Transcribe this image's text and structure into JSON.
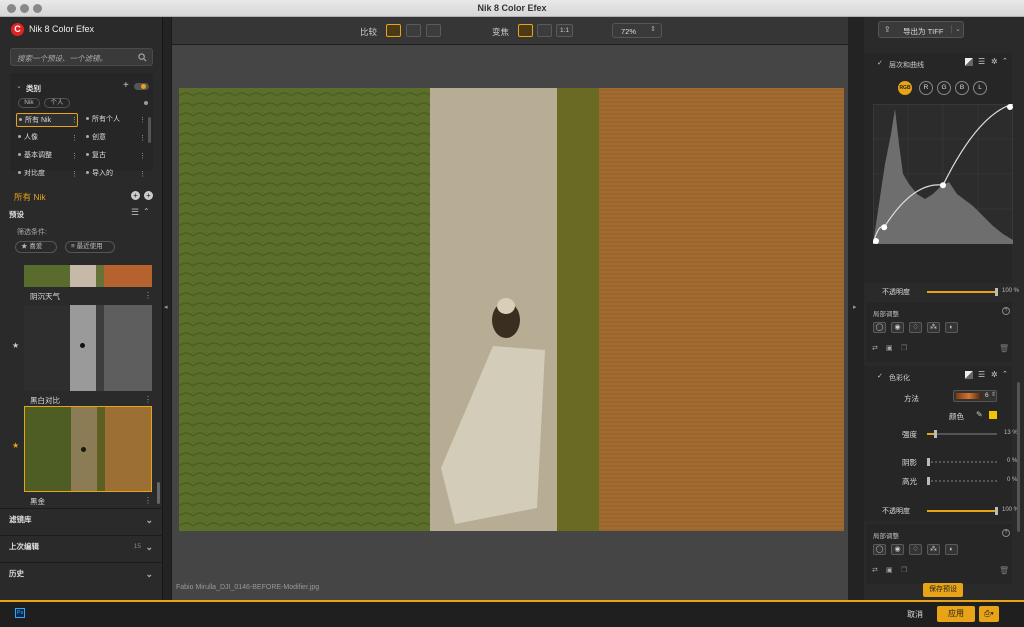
{
  "window": {
    "title": "Nik 8 Color Efex"
  },
  "app": {
    "name": "Nik 8 Color Efex",
    "logo_letter": "C"
  },
  "search": {
    "placeholder": "搜索一个预设、一个滤镜。"
  },
  "categories": {
    "title": "类别",
    "filters": [
      "Nik",
      "个人"
    ],
    "items": [
      "所有 Nik",
      "所有个人",
      "人像",
      "创意",
      "基本调整",
      "复古",
      "对比度",
      "导入的"
    ]
  },
  "collection": {
    "title": "所有 Nik"
  },
  "presets": {
    "title": "预设",
    "filter_label": "筛选条件:",
    "chip_favorites": "喜爱",
    "chip_recent": "最近使用",
    "items": [
      "阴沉天气",
      "黑白对比",
      "黑金"
    ]
  },
  "left_sections": {
    "filters_lib": "滤镜库",
    "last_edit": "上次编辑",
    "last_edit_count": "15",
    "history": "历史"
  },
  "toolbar": {
    "compare_label": "比较",
    "zoom_label": "变焦",
    "zoom_ratio": "1:1",
    "zoom_value": "72%"
  },
  "canvas": {
    "filename": "Fabio Mirulla_DJI_0146-BEFORE-Modifier.jpg"
  },
  "export": {
    "label": "导出为 TIFF"
  },
  "curves": {
    "title": "层次和曲线",
    "channels": [
      "RGB",
      "R",
      "G",
      "B",
      "L"
    ],
    "opacity_label": "不透明度",
    "opacity_value": "100 %",
    "opacity": 1.0,
    "curve_points": [
      [
        0,
        0
      ],
      [
        0.08,
        0.12
      ],
      [
        0.5,
        0.42
      ],
      [
        1,
        1
      ]
    ]
  },
  "local_adjust": {
    "title": "局部调整"
  },
  "colorize": {
    "title": "色彩化",
    "method_label": "方法",
    "method_value": "6",
    "color_label": "颜色",
    "strength_label": "强度",
    "strength_value": "13 %",
    "strength": 0.13,
    "shadow_label": "阴影",
    "shadow_value": "0 %",
    "highlight_label": "高光",
    "highlight_value": "0 %",
    "opacity_label": "不透明度",
    "opacity_value": "100 %",
    "opacity": 1.0
  },
  "save_preset": {
    "label": "保存预设"
  },
  "bottom": {
    "ps_badge": "Ps",
    "cancel": "取消",
    "apply": "应用"
  },
  "colors": {
    "accent": "#e8a317",
    "brand": "#e02424",
    "swatch": "#f2c400"
  },
  "icons": [
    "search-icon",
    "plus-icon",
    "toggle-icon",
    "star-icon",
    "list-icon",
    "chevron-up-icon",
    "chevron-down-icon",
    "export-icon",
    "checkbox-icon",
    "gear-icon",
    "eyedropper-icon",
    "trash-icon",
    "help-icon"
  ]
}
